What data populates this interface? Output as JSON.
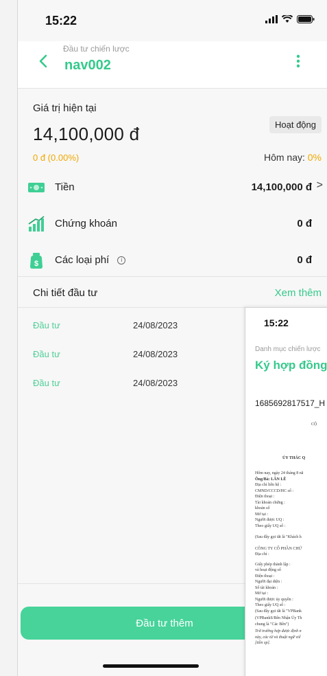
{
  "status_bar": {
    "time": "15:22"
  },
  "header": {
    "subtitle": "Đầu tư chiến lược",
    "title": "nav002"
  },
  "summary": {
    "label": "Giá trị hiện tại",
    "value": "14,100,000 đ",
    "change": "0 đ (0.00%)",
    "status_badge": "Hoạt động",
    "today_label": "Hôm nay:",
    "today_pct": "0%"
  },
  "assets": [
    {
      "name": "Tiền",
      "value": "14,100,000 đ",
      "chevron": ">"
    },
    {
      "name": "Chứng khoán",
      "value": "0 đ"
    },
    {
      "name": "Các loại phí",
      "value": "0 đ",
      "info": "i"
    }
  ],
  "details": {
    "title": "Chi tiết đầu tư",
    "see_more": "Xem thêm",
    "rows": [
      {
        "type": "Đầu tư",
        "date": "24/08/2023"
      },
      {
        "type": "Đầu tư",
        "date": "24/08/2023"
      },
      {
        "type": "Đầu tư",
        "date": "24/08/2023"
      }
    ]
  },
  "cta": {
    "label": "Đầu tư thêm"
  },
  "overlay": {
    "time": "15:22",
    "subtitle": "Danh mục chiến lược",
    "title": "Ký hợp đồng",
    "code": "1685692817517_H",
    "doc_lines": [
      "CỘ",
      "ỦY THÁC Q",
      "Hôm nay, ngày 24 tháng 8 nă",
      "Ông/Bà: LÂN LÊ",
      "Địa chỉ liên hệ   :",
      "CMND/CCCD/HC số   :",
      "Điện thoại   :",
      "Tài khoản chứng   :",
      "khoản số",
      "Mở tại   :",
      "Người được UQ   :",
      "Theo giấy UQ số   :",
      "(Sau đây gọi tắt là \"Khách h",
      "CÔNG TY CỔ PHẦN CHỨ",
      "Địa chỉ   :",
      "Giấy phép thành lập   :",
      "và hoạt động số",
      "Điện thoại   :",
      "Người đại diện   :",
      "Số tài khoản   :",
      "Mở tại   :",
      "Người được ủy quyền   :",
      "Theo giấy UQ số   :",
      "(Sau đây gọi tắt là \"VPBank",
      "(VPBankS/Bên Nhận Ủy Th",
      "chung là \"Các Bên\")",
      "Trừ trường hợp được định n",
      "này, các từ và thuật ngữ viế",
      "[tiền xp]."
    ]
  }
}
